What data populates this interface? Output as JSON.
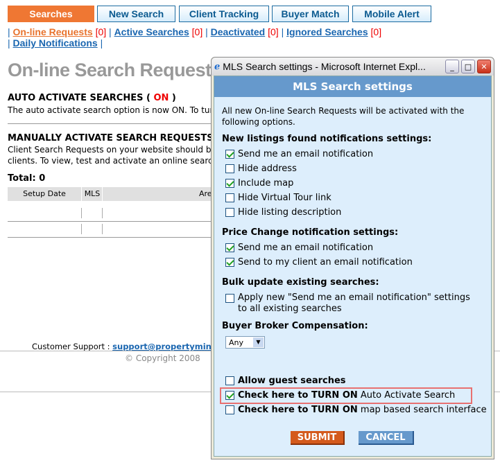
{
  "tabs": [
    {
      "label": "Searches",
      "active": true
    },
    {
      "label": "New Search"
    },
    {
      "label": "Client Tracking"
    },
    {
      "label": "Buyer Match"
    },
    {
      "label": "Mobile Alert"
    }
  ],
  "sublinks": [
    {
      "label": "On-line Requests",
      "count": "[0]"
    },
    {
      "label": "Active Searches",
      "count": "[0]"
    },
    {
      "label": "Deactivated",
      "count": "[0]"
    },
    {
      "label": "Ignored Searches",
      "count": "[0]"
    },
    {
      "label": "Daily Notifications"
    }
  ],
  "page": {
    "title": "On-line Search Requests",
    "auto_heading": "AUTO ACTIVATE SEARCHES (",
    "auto_status": "ON",
    "auto_close": ")",
    "auto_text": "The auto activate search option is now ON. To turn",
    "manual_heading": "MANUALLY ACTIVATE SEARCH REQUESTS",
    "manual_text1": "Client Search Requests on your website should be",
    "manual_text2": "clients. To view, test and activate an online search",
    "total": "Total: 0",
    "columns": [
      "Setup Date",
      "MLS",
      "Are"
    ],
    "support_label": "Customer Support :",
    "support_email": "support@propertymin",
    "copyright": "© Copyright 2008"
  },
  "popup": {
    "window_title": "MLS Search settings - Microsoft Internet Expl...",
    "header": "MLS Search settings",
    "intro": "All new On-line Search Requests will be activated with the following options.",
    "section1": "New listings found notifications settings:",
    "s1_items": [
      {
        "label": "Send me an email notification",
        "checked": true
      },
      {
        "label": "Hide address",
        "checked": false
      },
      {
        "label": "Include map",
        "checked": true
      },
      {
        "label": "Hide Virtual Tour link",
        "checked": false
      },
      {
        "label": "Hide listing description",
        "checked": false
      }
    ],
    "section2": "Price Change notification settings:",
    "s2_items": [
      {
        "label": "Send me an email notification",
        "checked": true
      },
      {
        "label": "Send to my client an email notification",
        "checked": true
      }
    ],
    "section3": "Bulk update existing searches:",
    "bulk_line1": "Apply new \"Send me an email notification\" settings",
    "bulk_line2": "to all existing searches",
    "bulk_checked": false,
    "section4": "Buyer Broker Compensation:",
    "compensation_value": "Any",
    "guest": "Allow guest searches",
    "guest_checked": false,
    "auto_bold": "Check here to TURN ON",
    "auto_rest": "Auto Activate Search",
    "auto_checked": true,
    "map_bold": "Check here to TURN ON",
    "map_rest": "map based search interface",
    "map_checked": false,
    "submit": "SUBMIT",
    "cancel": "CANCEL"
  },
  "colors": {
    "accent": "#ef7733",
    "link": "#1a66b0",
    "popup_header": "#6699cc",
    "popup_bg": "#ddeefc",
    "highlight": "#e87070"
  }
}
